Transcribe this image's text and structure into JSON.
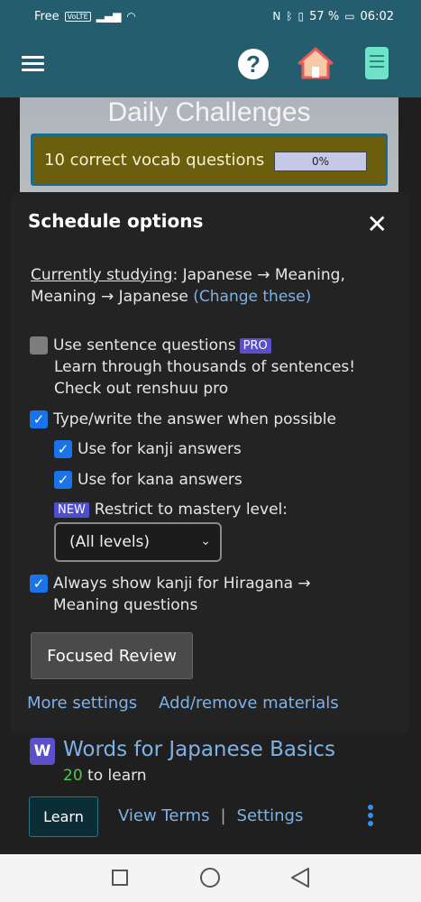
{
  "status_bar": {
    "carrier": "Free",
    "volte": "VoLTE",
    "battery": "57 %",
    "time": "06:02"
  },
  "header": {
    "icons": [
      "menu-icon",
      "help-icon",
      "home-icon",
      "book-icon"
    ]
  },
  "daily": {
    "title": "Daily Challenges",
    "challenge_label": "10 correct vocab questions",
    "progress": "0%"
  },
  "modal": {
    "title": "Schedule options",
    "close": "✕",
    "currently_label": "Currently studying",
    "currently_value": ": Japanese → Meaning, Meaning → Japanese ",
    "change_link": "(Change these)",
    "sentence_label": "Use sentence questions",
    "pro_badge": "PRO",
    "sentence_desc": "Learn through thousands of sentences!",
    "pro_link": "Check out renshuu pro",
    "type_label": "Type/write the answer when possible",
    "kanji_label": "Use for kanji answers",
    "kana_label": "Use for kana answers",
    "new_badge": "NEW",
    "restrict_label": "Restrict to mastery level:",
    "select_value": "(All levels)",
    "kanji_show_label": "Always show kanji for Hiragana → Meaning questions",
    "focused_button": "Focused Review",
    "more_settings": "More settings",
    "add_remove": "Add/remove materials"
  },
  "course": {
    "icon_letter": "W",
    "title": "Words for Japanese Basics",
    "count": "20",
    "count_suffix": " to learn",
    "learn": "Learn",
    "view_terms": "View Terms",
    "separator": "|",
    "settings": "Settings"
  }
}
